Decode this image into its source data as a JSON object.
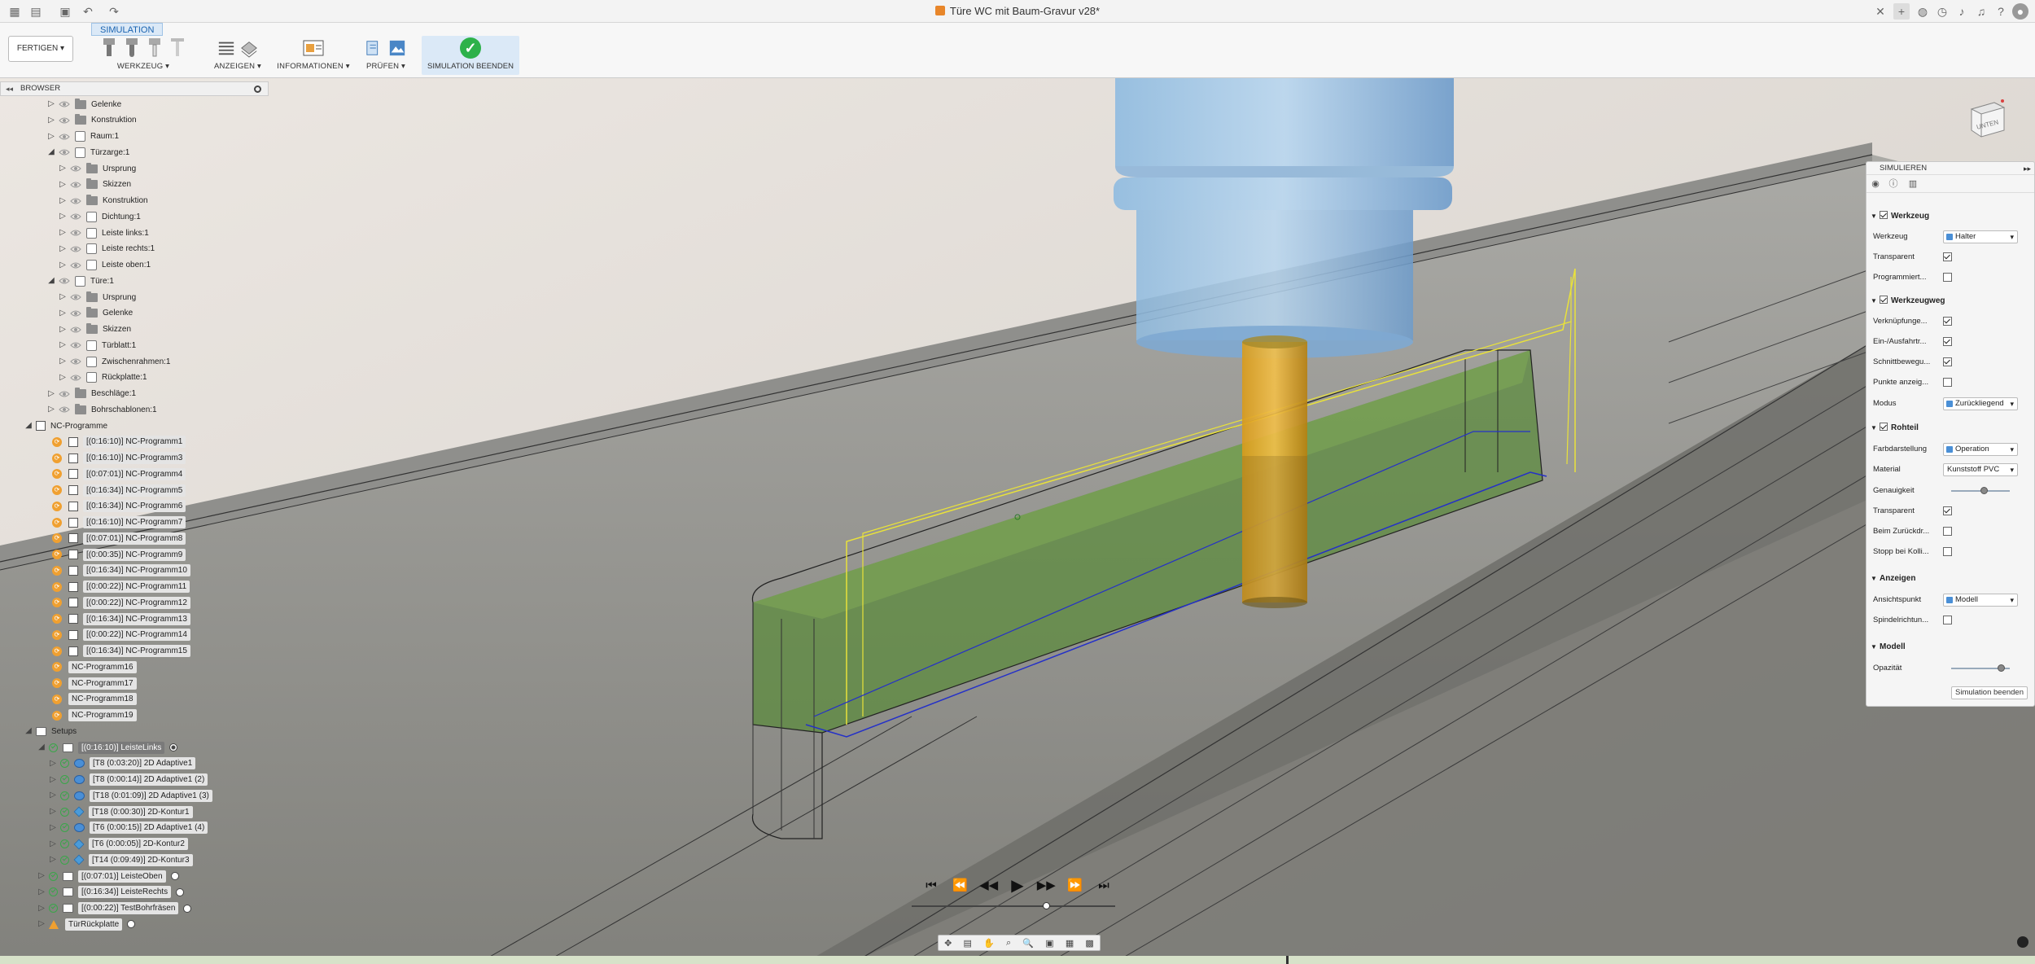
{
  "window": {
    "title": "Türe WC mit Baum-Gravur v28*"
  },
  "ribbon": {
    "active_tab": "SIMULATION",
    "workspace_button": "FERTIGEN",
    "groups": [
      "WERKZEUG",
      "ANZEIGEN",
      "INFORMATIONEN",
      "PRÜFEN",
      "SIMULATION BEENDEN"
    ]
  },
  "browser": {
    "title": "BROWSER",
    "items": [
      {
        "label": "Gelenke"
      },
      {
        "label": "Konstruktion"
      },
      {
        "label": "Raum:1"
      },
      {
        "label": "Türzarge:1"
      },
      {
        "label": "Ursprung"
      },
      {
        "label": "Skizzen"
      },
      {
        "label": "Konstruktion"
      },
      {
        "label": "Dichtung:1"
      },
      {
        "label": "Leiste links:1"
      },
      {
        "label": "Leiste rechts:1"
      },
      {
        "label": "Leiste oben:1"
      },
      {
        "label": "Türe:1"
      },
      {
        "label": "Ursprung"
      },
      {
        "label": "Gelenke"
      },
      {
        "label": "Skizzen"
      },
      {
        "label": "Türblatt:1"
      },
      {
        "label": "Zwischenrahmen:1"
      },
      {
        "label": "Rückplatte:1"
      },
      {
        "label": "Beschläge:1"
      },
      {
        "label": "Bohrschablonen:1"
      }
    ],
    "nc_root": "NC-Programme",
    "nc_programs": [
      "[(0:16:10)] NC-Programm1",
      "[(0:16:10)] NC-Programm3",
      "[(0:07:01)] NC-Programm4",
      "[(0:16:34)] NC-Programm5",
      "[(0:16:34)] NC-Programm6",
      "[(0:16:10)] NC-Programm7",
      "[(0:07:01)] NC-Programm8",
      "[(0:00:35)] NC-Programm9",
      "[(0:16:34)] NC-Programm10",
      "[(0:00:22)] NC-Programm11",
      "[(0:00:22)] NC-Programm12",
      "[(0:16:34)] NC-Programm13",
      "[(0:00:22)] NC-Programm14",
      "[(0:16:34)] NC-Programm15",
      "NC-Programm16",
      "NC-Programm17",
      "NC-Programm18",
      "NC-Programm19"
    ],
    "setups_root": "Setups",
    "setups": [
      {
        "label": "[(0:16:10)] LeisteLinks",
        "selected": true
      },
      {
        "label": "[T8 (0:03:20)] 2D Adaptive1",
        "op": true
      },
      {
        "label": "[T8 (0:00:14)] 2D Adaptive1 (2)",
        "op": true
      },
      {
        "label": "[T18 (0:01:09)] 2D Adaptive1 (3)",
        "op": true
      },
      {
        "label": "[T18 (0:00:30)] 2D-Kontur1",
        "op": true
      },
      {
        "label": "[T6 (0:00:15)] 2D Adaptive1 (4)",
        "op": true
      },
      {
        "label": "[T6 (0:00:05)] 2D-Kontur2",
        "op": true
      },
      {
        "label": "[T14 (0:09:49)] 2D-Kontur3",
        "op": true
      },
      {
        "label": "[(0:07:01)] LeisteOben"
      },
      {
        "label": "[(0:16:34)] LeisteRechts"
      },
      {
        "label": "[(0:00:22)] TestBohrfräsen"
      },
      {
        "label": "TürRückplatte",
        "warn": true
      }
    ]
  },
  "viewcube": {
    "label": "UNTEN"
  },
  "sim_panel": {
    "title": "SIMULIEREN",
    "sections": {
      "werkzeug": {
        "title": "Werkzeug",
        "rows": {
          "werkzeug": "Werkzeug",
          "werkzeug_val": "Halter",
          "transparent": "Transparent",
          "programmiert": "Programmiert..."
        }
      },
      "werkzeugweg": {
        "title": "Werkzeugweg",
        "rows": {
          "verkn": "Verknüpfunge...",
          "einaus": "Ein-/Ausfahrtr...",
          "schnitt": "Schnittbewegu...",
          "punkte": "Punkte anzeig...",
          "modus": "Modus",
          "modus_val": "Zurückliegend"
        }
      },
      "rohteil": {
        "title": "Rohteil",
        "rows": {
          "farb": "Farbdarstellung",
          "farb_val": "Operation",
          "material": "Material",
          "material_val": "Kunststoff PVC",
          "genauigkeit": "Genauigkeit",
          "transparent": "Transparent",
          "beim": "Beim Zurückdr...",
          "stopp": "Stopp bei Kolli..."
        }
      },
      "anzeigen": {
        "title": "Anzeigen",
        "rows": {
          "ansicht": "Ansichtspunkt",
          "ansicht_val": "Modell",
          "spindel": "Spindelrichtun..."
        }
      },
      "modell": {
        "title": "Modell",
        "rows": {
          "opazitaet": "Opazität"
        }
      }
    },
    "genauigkeit_level": 0.55,
    "opazitaet_level": 0.85,
    "button": "Simulation beenden"
  },
  "playback": {
    "position": 0.66
  },
  "colors": {
    "accent": "#1a63b0",
    "ok": "#2db14a",
    "warn": "#f0a030",
    "stock": "#5a8a3a",
    "tool": "#7fb3dc",
    "holder": "#e0a020"
  }
}
